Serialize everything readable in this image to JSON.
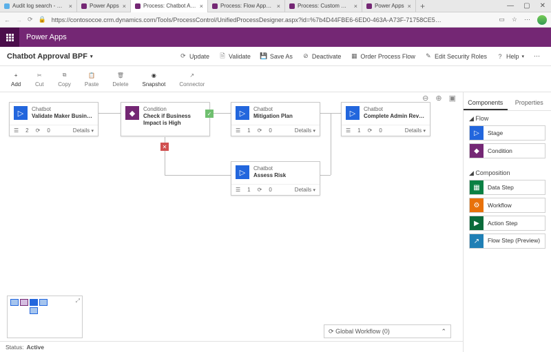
{
  "browser": {
    "tabs": [
      {
        "label": "Audit log search - Security",
        "favColor": "#5bb0e8"
      },
      {
        "label": "Power Apps",
        "favColor": "#742774"
      },
      {
        "label": "Process: Chatbot Approval",
        "favColor": "#742774",
        "active": true
      },
      {
        "label": "Process: Flow Approval BPF",
        "favColor": "#742774"
      },
      {
        "label": "Process: Custom Connector",
        "favColor": "#742774"
      },
      {
        "label": "Power Apps",
        "favColor": "#742774"
      }
    ],
    "url": "https://contosocoe.crm.dynamics.com/Tools/ProcessControl/UnifiedProcessDesigner.aspx?id=%7b4D44FBE6-6ED0-463A-A73F-71758CE5…"
  },
  "app": {
    "title": "Power Apps"
  },
  "bpf": {
    "title": "Chatbot Approval BPF"
  },
  "commands": {
    "update": "Update",
    "validate": "Validate",
    "saveAs": "Save As",
    "deactivate": "Deactivate",
    "orderFlow": "Order Process Flow",
    "editRoles": "Edit Security Roles",
    "help": "Help"
  },
  "tools": {
    "add": "Add",
    "cut": "Cut",
    "copy": "Copy",
    "paste": "Paste",
    "delete": "Delete",
    "snapshot": "Snapshot",
    "connector": "Connector"
  },
  "nodes": {
    "n1": {
      "type": "Chatbot",
      "title": "Validate Maker Business Require…",
      "left": "2",
      "right": "0",
      "details": "Details"
    },
    "n2": {
      "type": "Condition",
      "title": "Check if Business Impact is High"
    },
    "n3": {
      "type": "Chatbot",
      "title": "Mitigation Plan",
      "left": "1",
      "right": "0",
      "details": "Details"
    },
    "n4": {
      "type": "Chatbot",
      "title": "Complete Admin Review",
      "left": "1",
      "right": "0",
      "details": "Details"
    },
    "n5": {
      "type": "Chatbot",
      "title": "Assess Risk",
      "left": "1",
      "right": "0",
      "details": "Details"
    }
  },
  "globalWorkflow": "Global Workflow (0)",
  "status": {
    "label": "Status:",
    "value": "Active"
  },
  "panel": {
    "tabs": {
      "components": "Components",
      "properties": "Properties"
    },
    "secFlow": "Flow",
    "secComposition": "Composition",
    "items": {
      "stage": "Stage",
      "condition": "Condition",
      "dataStep": "Data Step",
      "workflow": "Workflow",
      "actionStep": "Action Step",
      "flowStep": "Flow Step (Preview)"
    }
  }
}
